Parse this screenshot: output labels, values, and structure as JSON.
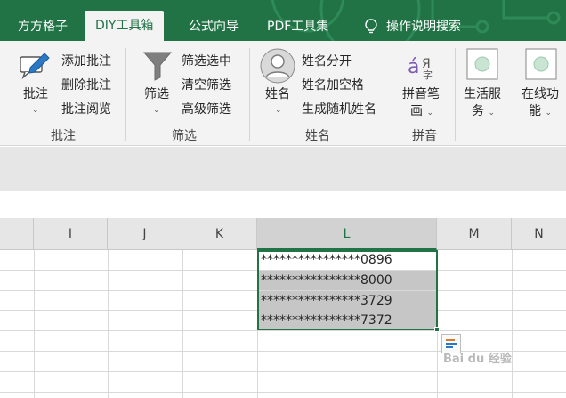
{
  "tabs": [
    {
      "label": "方方格子"
    },
    {
      "label": "DIY工具箱"
    },
    {
      "label": "公式向导"
    },
    {
      "label": "PDF工具集"
    },
    {
      "label": "操作说明搜索"
    }
  ],
  "ribbon": {
    "annotation": {
      "big_button_label": "批注",
      "items": [
        "添加批注",
        "删除批注",
        "批注阅览"
      ],
      "group_label": "批注"
    },
    "filter": {
      "big_button_label": "筛选",
      "items": [
        "筛选选中",
        "清空筛选",
        "高级筛选"
      ],
      "group_label": "筛选"
    },
    "name": {
      "big_button_label": "姓名",
      "items": [
        "姓名分开",
        "姓名加空格",
        "生成随机姓名"
      ],
      "group_label": "姓名"
    },
    "pinyin": {
      "big_button_line1": "拼音笔",
      "big_button_line2": "画",
      "group_label": "拼音"
    },
    "life": {
      "line1": "生活服",
      "line2": "务"
    },
    "online": {
      "line1": "在线功",
      "line2": "能"
    }
  },
  "sheet": {
    "columns": [
      "I",
      "J",
      "K",
      "L",
      "M",
      "N"
    ],
    "selected_column": "L",
    "cells": [
      "****************0896",
      "****************8000",
      "****************3729",
      "****************7372"
    ]
  },
  "watermark": "Bai du 经验",
  "colors": {
    "excel_green": "#217346",
    "ribbon_bg": "#f3f3f3",
    "selection_gray": "#c6c6c6"
  }
}
